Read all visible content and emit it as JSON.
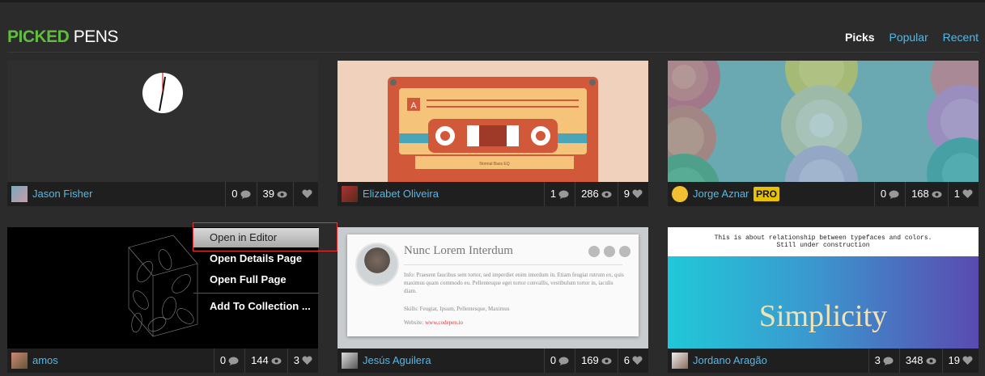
{
  "header": {
    "logo_bold": "PICKED",
    "logo_light": "PENS",
    "nav": [
      "Picks",
      "Popular",
      "Recent"
    ]
  },
  "cards": [
    {
      "author": "Jason Fisher",
      "comments": "0",
      "views": "39",
      "hearts": "",
      "pro": ""
    },
    {
      "author": "Elizabet Oliveira",
      "comments": "1",
      "views": "286",
      "hearts": "9",
      "cassette_text": "Normal Bass EQ",
      "cassette_letter": "A"
    },
    {
      "author": "Jorge Aznar",
      "comments": "0",
      "views": "168",
      "hearts": "1",
      "pro": "PRO"
    },
    {
      "author": "amos",
      "comments": "0",
      "views": "144",
      "hearts": "3"
    },
    {
      "author": "Jesús Aguilera",
      "comments": "0",
      "views": "169",
      "hearts": "6",
      "profile": {
        "title": "Nunc Lorem Interdum",
        "info": "Info: Praesent faucibus sem tortor, sed imperdiet enim interdum in. Etiam feugiat rutrum ex, quis maximus quam commodo eu. Pellentesque eget tortor convallis, vestibulum tortor in, iaculis diam.",
        "skills": "Skills: Feugiat, Ipsum, Pellentesque, Maximus",
        "website_label": "Website:",
        "website": "www.codepen.io"
      }
    },
    {
      "author": "Jordano Aragão",
      "comments": "3",
      "views": "348",
      "hearts": "19",
      "note_line1": "This is about relationship between typefaces and colors.",
      "note_line2": "Still under construction",
      "big_text": "Simplicity"
    }
  ],
  "context_menu": [
    "Open in Editor",
    "Open Details Page",
    "Open Full Page",
    "Add To Collection ..."
  ],
  "colors": {
    "accent_green": "#5fbf3b",
    "link_blue": "#55b8e6",
    "pro_yellow": "#e8c100",
    "highlight_red": "#e33333"
  }
}
